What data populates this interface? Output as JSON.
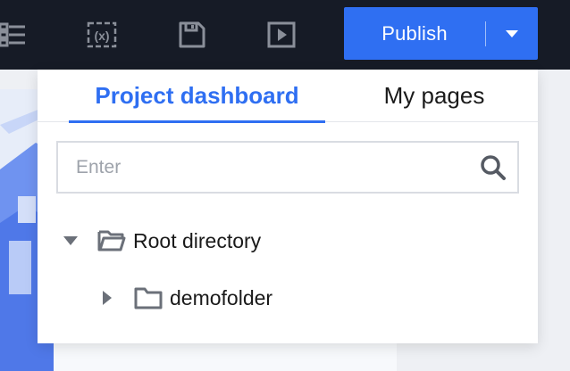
{
  "toolbar": {
    "icons": [
      "settings-sliders-icon",
      "variables-icon",
      "save-icon",
      "preview-icon"
    ],
    "variables_glyph": "(x)",
    "publish_label": "Publish"
  },
  "dropdown": {
    "tabs": [
      {
        "label": "Project dashboard",
        "active": true
      },
      {
        "label": "My pages",
        "active": false
      }
    ],
    "search": {
      "placeholder": "Enter",
      "value": ""
    },
    "tree": [
      {
        "label": "Root directory",
        "expanded": true,
        "level": 0
      },
      {
        "label": "demofolder",
        "expanded": false,
        "level": 1
      }
    ]
  },
  "colors": {
    "accent": "#2f6ff2",
    "topbar": "#161b26",
    "icon": "#8a8f99"
  }
}
